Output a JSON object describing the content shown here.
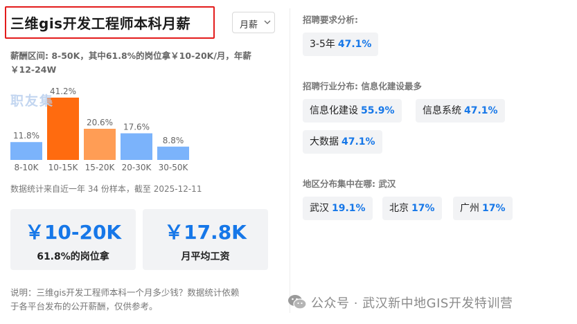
{
  "header": {
    "title": "三维gis开发工程师本科月薪",
    "select_label": "月薪"
  },
  "summary": {
    "line1": "薪酬区间: 8-50K，其中61.8%的岗位拿￥10-20K/月，年薪",
    "line2": "￥12-24W"
  },
  "watermark": "职友集",
  "chart_data": {
    "type": "bar",
    "categories": [
      "8-10K",
      "10-15K",
      "15-20K",
      "20-30K",
      "30-50K"
    ],
    "values": [
      11.8,
      41.2,
      20.6,
      17.6,
      8.8
    ],
    "value_labels": [
      "11.8%",
      "41.2%",
      "20.6%",
      "17.6%",
      "8.8%"
    ],
    "colors": [
      "#7bb3fb",
      "#ff6b0f",
      "#ff9d55",
      "#7bb3fb",
      "#7bb3fb"
    ],
    "ylim": [
      0,
      41.2
    ]
  },
  "stats_note": "数据统计来自近一年 34 份样本，截至 2025-12-11",
  "cards": [
    {
      "value": "￥10-20K",
      "label": "61.8%的岗位拿"
    },
    {
      "value": "￥17.8K",
      "label": "月平均工资"
    }
  ],
  "footnote": {
    "line1": "说明：三维gis开发工程师本科一个月多少钱？数据统计依赖",
    "line2": "于各平台发布的公开薪酬，仅供参考。"
  },
  "requirements": {
    "title": "招聘要求分析:",
    "tags": [
      {
        "name": "3-5年",
        "pct": "47.1%"
      }
    ]
  },
  "industry": {
    "title": "招聘行业分布: 信息化建设最多",
    "tags": [
      {
        "name": "信息化建设",
        "pct": "55.9%"
      },
      {
        "name": "信息系统",
        "pct": "47.1%"
      },
      {
        "name": "大数据",
        "pct": "47.1%"
      }
    ]
  },
  "region": {
    "title": "地区分布集中在哪: 武汉",
    "tags": [
      {
        "name": "武汉",
        "pct": "19.1%"
      },
      {
        "name": "北京",
        "pct": "17%"
      },
      {
        "name": "广州",
        "pct": "17%"
      }
    ]
  },
  "wechat": {
    "text": "公众号 · 武汉新中地GIS开发特训营",
    "accent": "#1677e8"
  }
}
